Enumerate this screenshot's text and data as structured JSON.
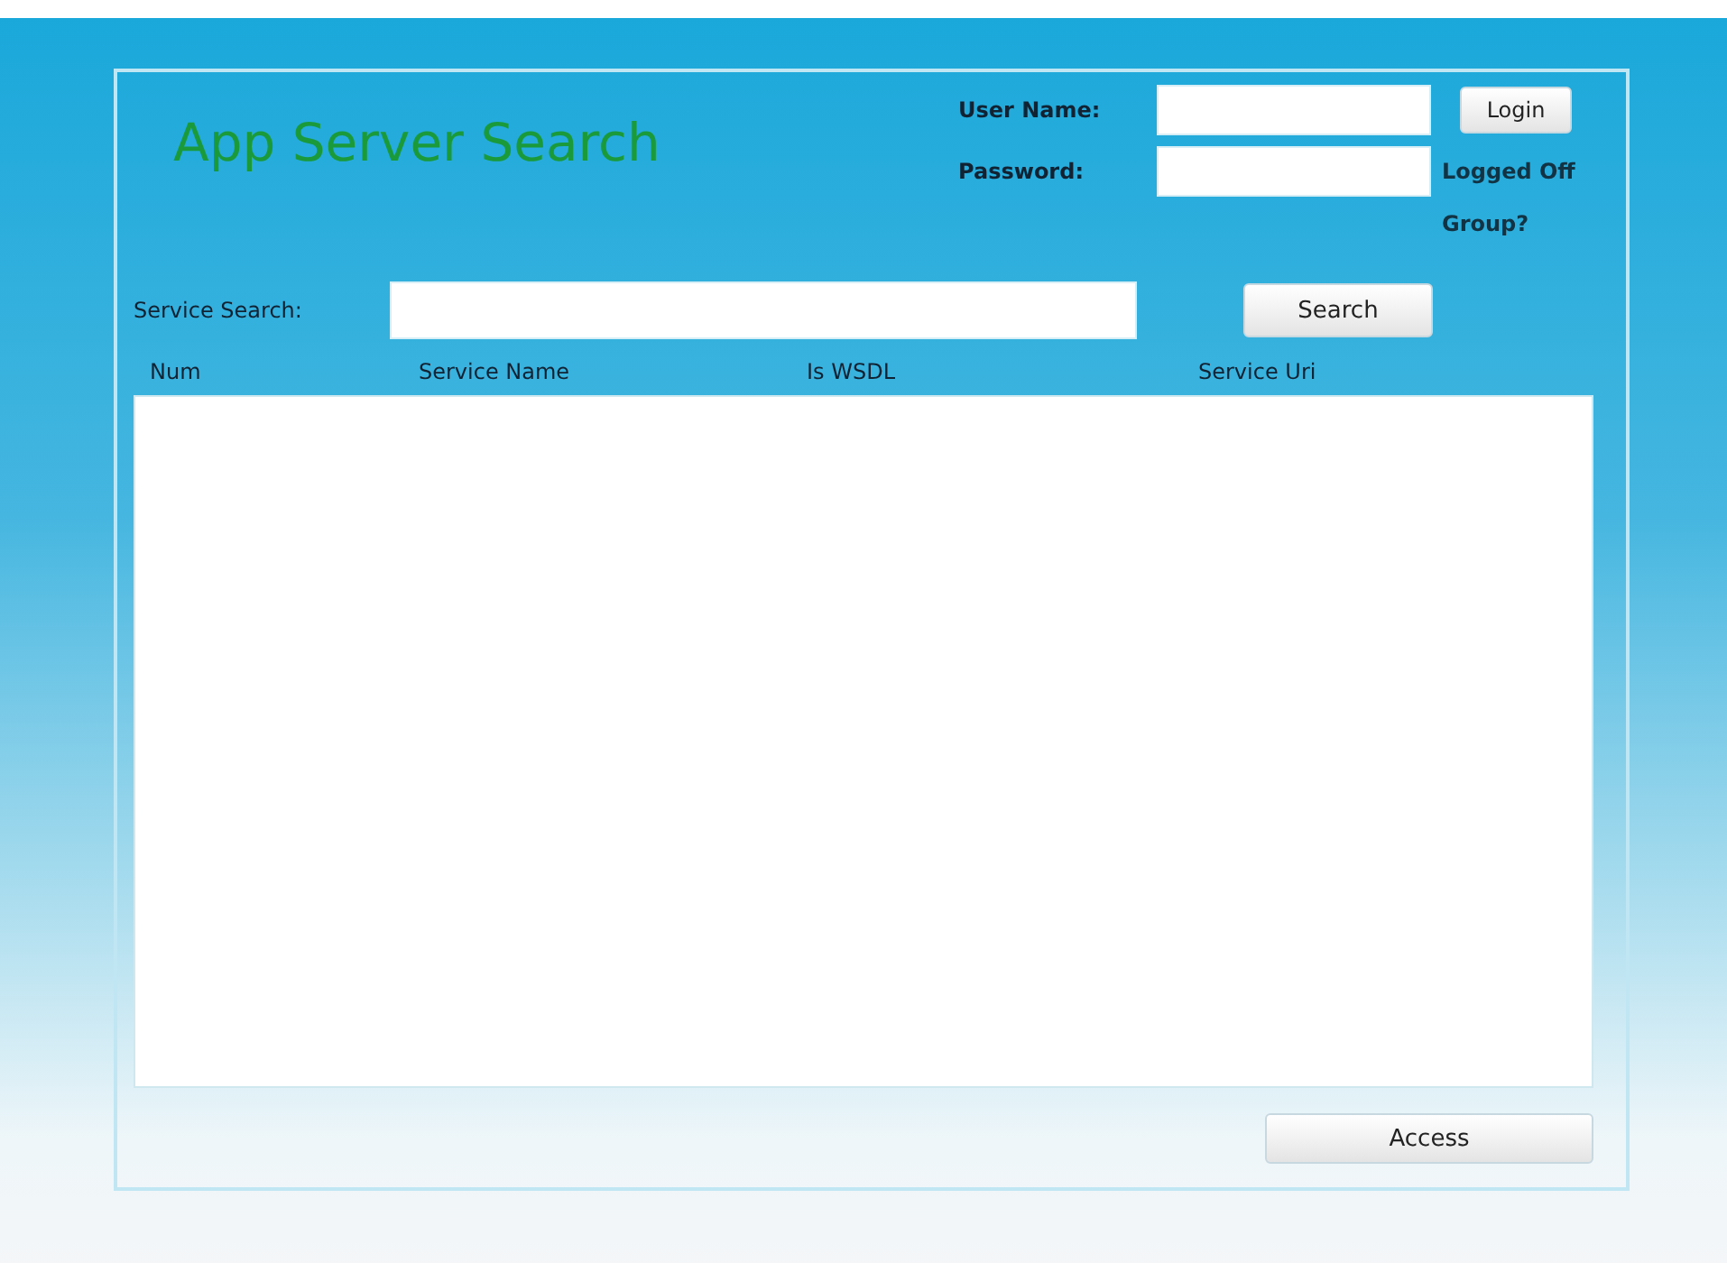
{
  "title": "App Server Search",
  "login": {
    "user_label": "User Name:",
    "password_label": "Password:",
    "login_button": "Login",
    "status": "Logged Off",
    "group": "Group?"
  },
  "search": {
    "label": "Service Search:",
    "button": "Search"
  },
  "table": {
    "columns": [
      "Num",
      "Service Name",
      "Is WSDL",
      "Service Uri"
    ]
  },
  "access_button": "Access"
}
